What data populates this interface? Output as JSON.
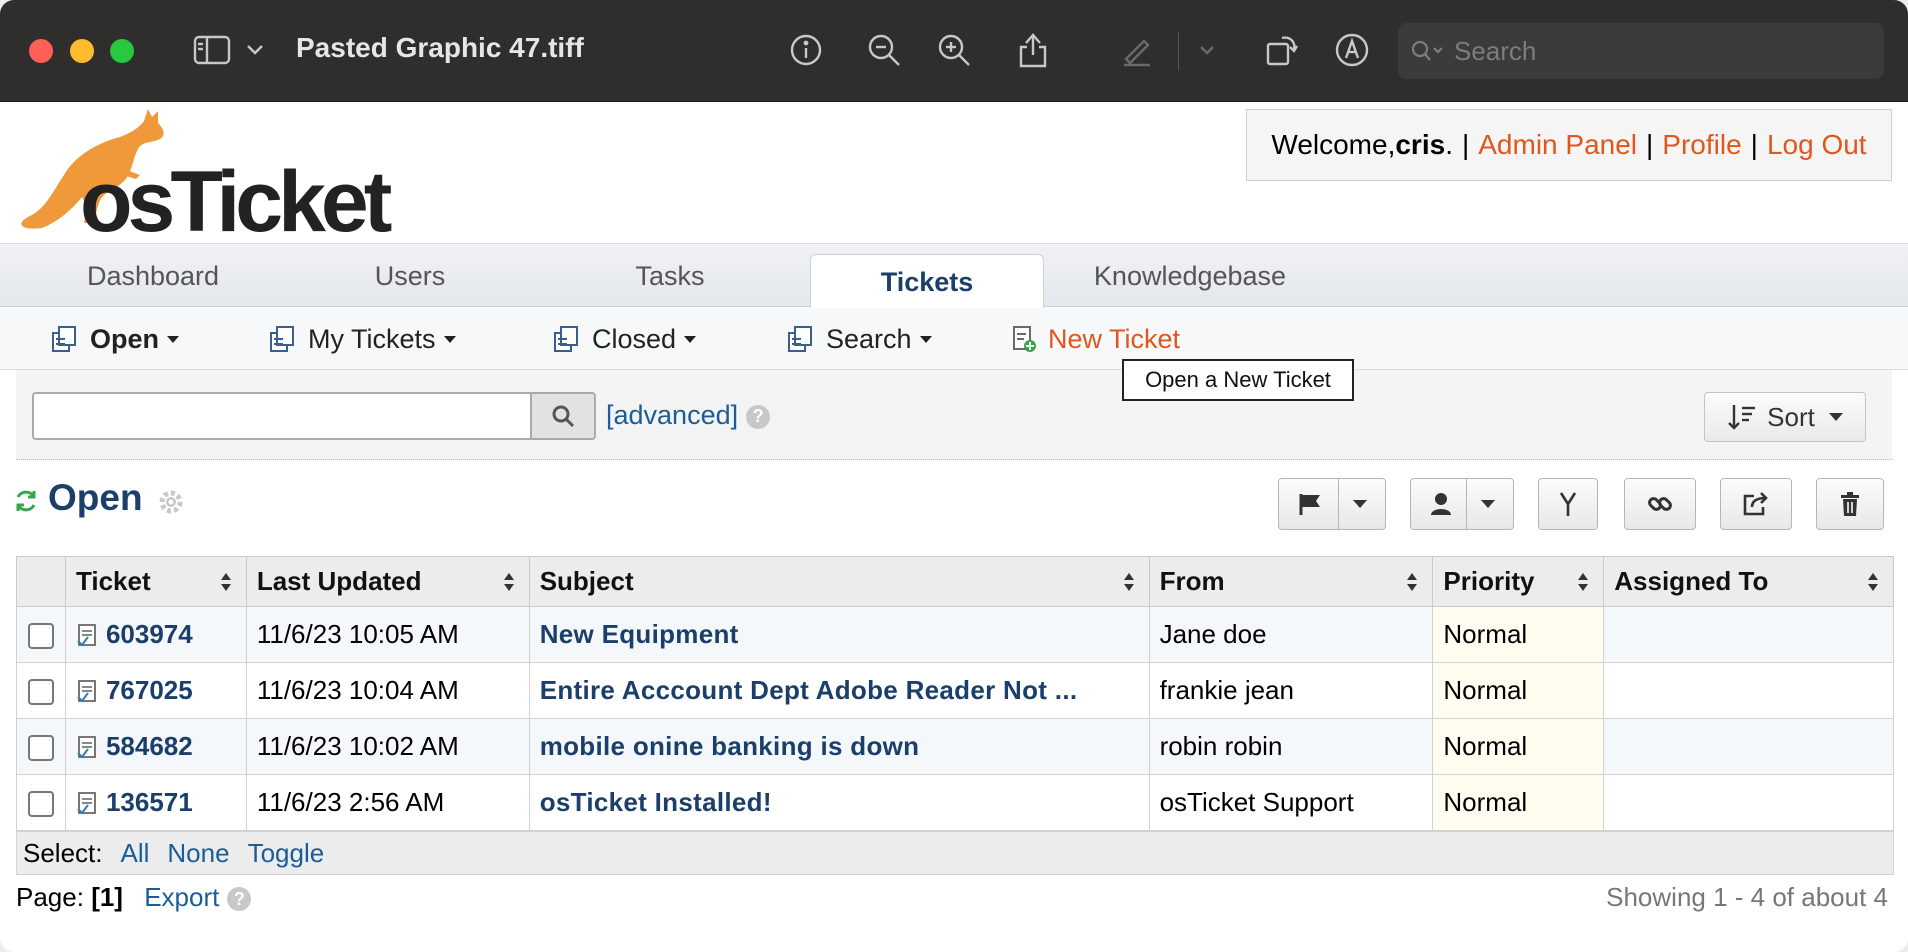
{
  "window": {
    "title": "Pasted Graphic 47.tiff",
    "search_placeholder": "Search"
  },
  "welcome": {
    "prefix": "Welcome, ",
    "user": "cris",
    "suffix": ".",
    "sep": "|",
    "admin_panel": "Admin Panel",
    "profile": "Profile",
    "logout": "Log Out"
  },
  "logo": {
    "text": "osTicket"
  },
  "nav": {
    "tabs": [
      {
        "label": "Dashboard"
      },
      {
        "label": "Users"
      },
      {
        "label": "Tasks"
      },
      {
        "label": "Tickets"
      },
      {
        "label": "Knowledgebase"
      }
    ],
    "active": "Tickets"
  },
  "subnav": {
    "open": "Open",
    "my_tickets": "My Tickets",
    "closed": "Closed",
    "search": "Search",
    "new_ticket": "New Ticket"
  },
  "tooltip": "Open a New Ticket",
  "search": {
    "value": "",
    "advanced": "[advanced]",
    "help": "?",
    "sort": "Sort"
  },
  "queue": {
    "title": "Open"
  },
  "table": {
    "headers": [
      "Ticket",
      "Last Updated",
      "Subject",
      "From",
      "Priority",
      "Assigned To"
    ],
    "rows": [
      {
        "number": "603974",
        "updated": "11/6/23 10:05 AM",
        "subject": "New Equipment",
        "from": "Jane doe",
        "priority": "Normal",
        "assigned": ""
      },
      {
        "number": "767025",
        "updated": "11/6/23 10:04 AM",
        "subject": "Entire Acccount Dept Adobe Reader Not ...",
        "from": "frankie jean",
        "priority": "Normal",
        "assigned": ""
      },
      {
        "number": "584682",
        "updated": "11/6/23 10:02 AM",
        "subject": "mobile onine banking is down",
        "from": "robin robin",
        "priority": "Normal",
        "assigned": ""
      },
      {
        "number": "136571",
        "updated": "11/6/23 2:56 AM",
        "subject": "osTicket Installed!",
        "from": "osTicket Support",
        "priority": "Normal",
        "assigned": ""
      }
    ]
  },
  "select": {
    "label": "Select:",
    "all": "All",
    "none": "None",
    "toggle": "Toggle"
  },
  "pager": {
    "label": "Page:",
    "current": "[1]",
    "export": "Export",
    "help": "?"
  },
  "showing": "Showing 1 - 4 of about 4",
  "colors": {
    "accent": "#e0571d",
    "link": "#1b5d96",
    "title": "#1b3e6b",
    "kangaroo": "#f0993a"
  }
}
